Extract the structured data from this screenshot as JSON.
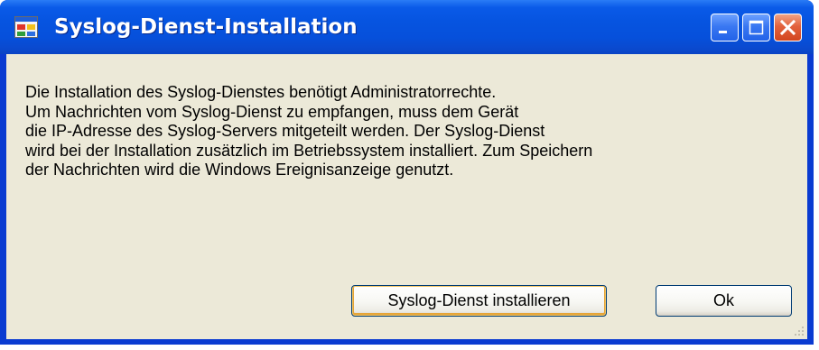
{
  "window": {
    "title": "Syslog-Dienst-Installation",
    "icon": "application-window-icon",
    "controls": {
      "minimize": "minimize-icon",
      "maximize": "maximize-icon",
      "close": "close-icon"
    }
  },
  "message": {
    "lines": [
      "Die Installation des Syslog-Dienstes benötigt Administratorrechte.",
      "Um Nachrichten vom Syslog-Dienst zu empfangen, muss dem Gerät",
      "die IP-Adresse des Syslog-Servers mitgeteilt werden. Der Syslog-Dienst",
      "wird bei der Installation zusätzlich im Betriebssystem installiert. Zum Speichern",
      "der Nachrichten wird die Windows Ereignisanzeige genutzt."
    ]
  },
  "buttons": {
    "install": "Syslog-Dienst installieren",
    "ok": "Ok"
  },
  "colors": {
    "titlebar": "#0654e0",
    "client_background": "#ece9d8",
    "close_button": "#d2461f",
    "default_button_focus": "#f7c766"
  }
}
